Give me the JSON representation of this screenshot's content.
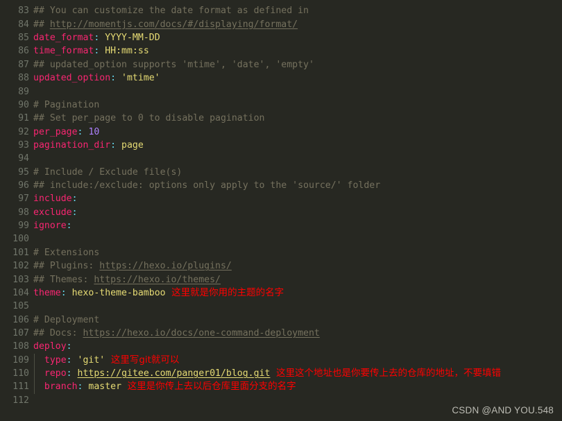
{
  "editor": {
    "theme_name": "monokai-dark",
    "background_color": "#272822",
    "gutter_color": "#70756a",
    "language": "yaml",
    "file_kind": "hexo _config.yml",
    "indent_guide_color": "#4d5044",
    "colors": {
      "comment": "#75715e",
      "key": "#f92672",
      "punctuation": "#66d9ef",
      "string_value": "#e6db74",
      "number": "#ae81ff",
      "annotation_red": "#ff0000",
      "watermark": "#d0d0c8"
    }
  },
  "watermark": {
    "text": "CSDN @AND YOU.548"
  },
  "lines": [
    {
      "number": "",
      "clipped": true,
      "tokens": [
        {
          "text": "## You can customize the date format as defined in",
          "kind": "comment"
        }
      ]
    },
    {
      "number": "83",
      "tokens": [
        {
          "text": "## You can customize the date format as defined in",
          "kind": "comment"
        }
      ]
    },
    {
      "number": "84",
      "tokens": [
        {
          "text": "## ",
          "kind": "comment"
        },
        {
          "text": "http://momentjs.com/docs/#/displaying/format/",
          "kind": "link"
        }
      ]
    },
    {
      "number": "85",
      "tokens": [
        {
          "text": "date_format",
          "kind": "key"
        },
        {
          "text": ":",
          "kind": "punct"
        },
        {
          "text": " YYYY-MM-DD",
          "kind": "value"
        }
      ]
    },
    {
      "number": "86",
      "tokens": [
        {
          "text": "time_format",
          "kind": "key"
        },
        {
          "text": ":",
          "kind": "punct"
        },
        {
          "text": " HH:mm:ss",
          "kind": "value"
        }
      ]
    },
    {
      "number": "87",
      "tokens": [
        {
          "text": "## updated_option supports 'mtime', 'date', 'empty'",
          "kind": "comment"
        }
      ]
    },
    {
      "number": "88",
      "tokens": [
        {
          "text": "updated_option",
          "kind": "key"
        },
        {
          "text": ":",
          "kind": "punct"
        },
        {
          "text": " 'mtime'",
          "kind": "value"
        }
      ]
    },
    {
      "number": "89",
      "tokens": []
    },
    {
      "number": "90",
      "tokens": [
        {
          "text": "# Pagination",
          "kind": "comment"
        }
      ]
    },
    {
      "number": "91",
      "tokens": [
        {
          "text": "## Set per_page to 0 to disable pagination",
          "kind": "comment"
        }
      ]
    },
    {
      "number": "92",
      "tokens": [
        {
          "text": "per_page",
          "kind": "key"
        },
        {
          "text": ":",
          "kind": "punct"
        },
        {
          "text": " ",
          "kind": "plain"
        },
        {
          "text": "10",
          "kind": "num"
        }
      ]
    },
    {
      "number": "93",
      "tokens": [
        {
          "text": "pagination_dir",
          "kind": "key"
        },
        {
          "text": ":",
          "kind": "punct"
        },
        {
          "text": " page",
          "kind": "value"
        }
      ]
    },
    {
      "number": "94",
      "tokens": []
    },
    {
      "number": "95",
      "tokens": [
        {
          "text": "# Include / Exclude file(s)",
          "kind": "comment"
        }
      ]
    },
    {
      "number": "96",
      "tokens": [
        {
          "text": "## include:/exclude: options only apply to the 'source/' folder",
          "kind": "comment"
        }
      ]
    },
    {
      "number": "97",
      "tokens": [
        {
          "text": "include",
          "kind": "key"
        },
        {
          "text": ":",
          "kind": "punct"
        }
      ]
    },
    {
      "number": "98",
      "tokens": [
        {
          "text": "exclude",
          "kind": "key"
        },
        {
          "text": ":",
          "kind": "punct"
        }
      ]
    },
    {
      "number": "99",
      "tokens": [
        {
          "text": "ignore",
          "kind": "key"
        },
        {
          "text": ":",
          "kind": "punct"
        }
      ]
    },
    {
      "number": "100",
      "tokens": []
    },
    {
      "number": "101",
      "tokens": [
        {
          "text": "# Extensions",
          "kind": "comment"
        }
      ]
    },
    {
      "number": "102",
      "tokens": [
        {
          "text": "## Plugins: ",
          "kind": "comment"
        },
        {
          "text": "https://hexo.io/plugins/",
          "kind": "link"
        }
      ]
    },
    {
      "number": "103",
      "tokens": [
        {
          "text": "## Themes: ",
          "kind": "comment"
        },
        {
          "text": "https://hexo.io/themes/",
          "kind": "link"
        }
      ]
    },
    {
      "number": "104",
      "tokens": [
        {
          "text": "theme",
          "kind": "key"
        },
        {
          "text": ":",
          "kind": "punct"
        },
        {
          "text": " hexo-theme-bamboo",
          "kind": "value"
        },
        {
          "text": "  这里就是你用的主题的名字",
          "kind": "note"
        }
      ]
    },
    {
      "number": "105",
      "tokens": []
    },
    {
      "number": "106",
      "tokens": [
        {
          "text": "# Deployment",
          "kind": "comment"
        }
      ]
    },
    {
      "number": "107",
      "tokens": [
        {
          "text": "## Docs: ",
          "kind": "comment"
        },
        {
          "text": "https://hexo.io/docs/one-command-deployment",
          "kind": "link"
        }
      ]
    },
    {
      "number": "108",
      "tokens": [
        {
          "text": "deploy",
          "kind": "key"
        },
        {
          "text": ":",
          "kind": "punct"
        }
      ]
    },
    {
      "number": "109",
      "tokens": [
        {
          "text": "  type",
          "kind": "key"
        },
        {
          "text": ":",
          "kind": "punct"
        },
        {
          "text": " 'git'",
          "kind": "value"
        },
        {
          "text": "  这里写git就可以",
          "kind": "note"
        }
      ]
    },
    {
      "number": "110",
      "tokens": [
        {
          "text": "  repo",
          "kind": "key"
        },
        {
          "text": ":",
          "kind": "punct"
        },
        {
          "text": " ",
          "kind": "plain"
        },
        {
          "text": "https://gitee.com/panger01/blog.git",
          "kind": "linkval"
        },
        {
          "text": "  这里这个地址也是你要传上去的仓库的地址，不要填错",
          "kind": "note"
        }
      ]
    },
    {
      "number": "111",
      "tokens": [
        {
          "text": "  branch",
          "kind": "key"
        },
        {
          "text": ":",
          "kind": "punct"
        },
        {
          "text": " master",
          "kind": "value"
        },
        {
          "text": "  这里是你传上去以后仓库里面分支的名字",
          "kind": "note"
        }
      ]
    },
    {
      "number": "112",
      "tokens": []
    }
  ]
}
